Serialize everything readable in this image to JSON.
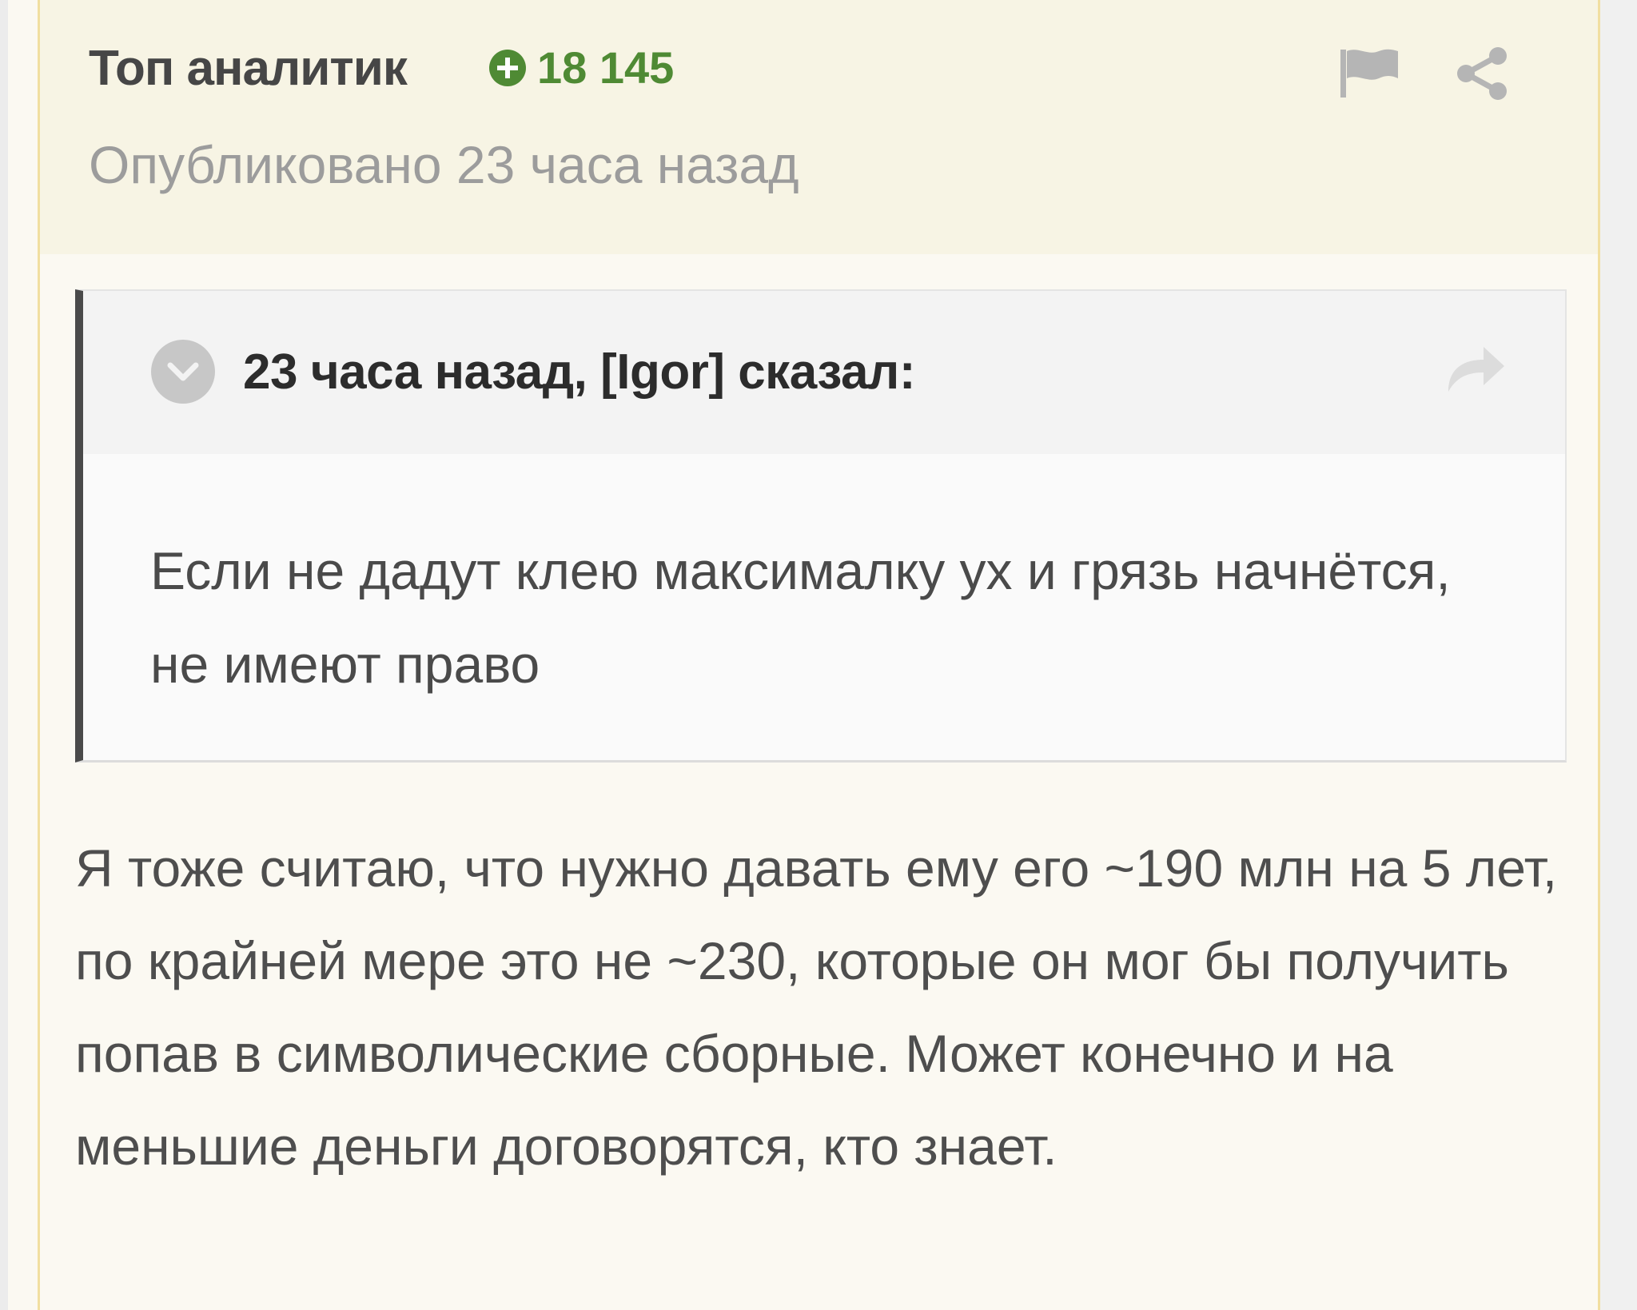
{
  "post": {
    "author": "Топ аналитик",
    "reputation": "18 145",
    "published": "Опубликовано 23 часа назад",
    "icons": {
      "reputation": "plus-circle-icon",
      "report": "flag-icon",
      "share": "share-icon"
    },
    "colors": {
      "reputation": "#4f8a34",
      "card_border": "#f1dfa0",
      "header_bg": "#f7f4e4"
    }
  },
  "quote": {
    "citation": "23 часа назад, [Igor] сказал:",
    "text": "Если не дадут клею максималку ух и грязь начнётся, не имеют право",
    "icons": {
      "toggle": "chevron-down-circle-icon",
      "jump": "share-arrow-icon"
    }
  },
  "body": {
    "text": "Я тоже считаю, что нужно давать ему его ~190 млн на 5 лет, по крайней мере это не ~230, которые он мог бы получить попав в символические сборные. Может конечно и на меньшие деньги договорятся, кто знает."
  }
}
